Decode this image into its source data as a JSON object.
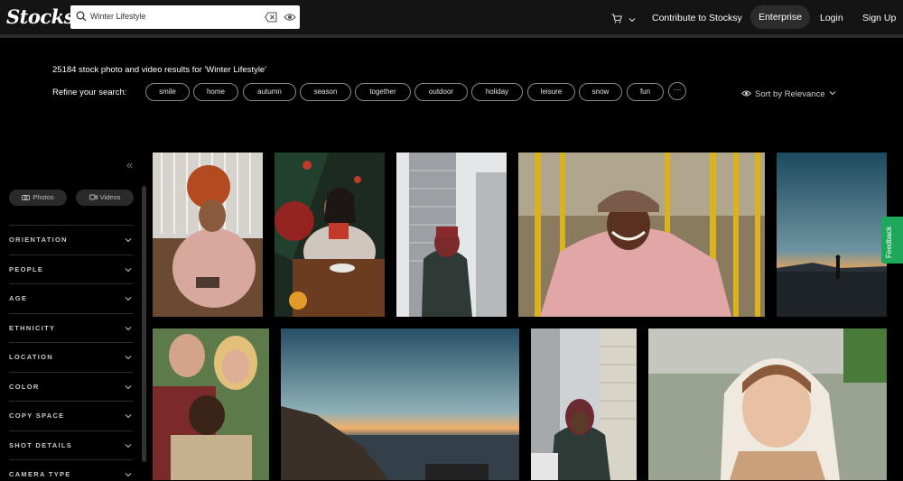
{
  "header": {
    "logo": "Stocksy",
    "search_value": "Winter Lifestyle",
    "contribute": "Contribute to Stocksy",
    "enterprise": "Enterprise",
    "login": "Login",
    "signup": "Sign Up"
  },
  "results": {
    "count_text": "25184 stock photo and video results for 'Winter Lifestyle'",
    "refine_label": "Refine your search:",
    "tags": [
      "smile",
      "home",
      "autumn",
      "season",
      "together",
      "outdoor",
      "holiday",
      "leisure",
      "snow",
      "fun"
    ],
    "more": "···",
    "sort_label": "Sort by Relevance"
  },
  "sidebar": {
    "collapse": "«",
    "photos_label": "Photos",
    "videos_label": "Videos",
    "filters": [
      "ORIENTATION",
      "PEOPLE",
      "AGE",
      "ETHNICITY",
      "LOCATION",
      "COLOR",
      "COPY SPACE",
      "SHOT DETAILS",
      "CAMERA TYPE"
    ]
  },
  "feedback": "Feedback",
  "icons": [
    "search-icon",
    "clear-icon",
    "visibility-icon",
    "cart-icon",
    "chevron-down-icon",
    "camera-icon",
    "video-icon"
  ],
  "colors": {
    "accent_feedback": "#1fa85c",
    "header_bg": "#141414",
    "page_bg": "#000000"
  }
}
